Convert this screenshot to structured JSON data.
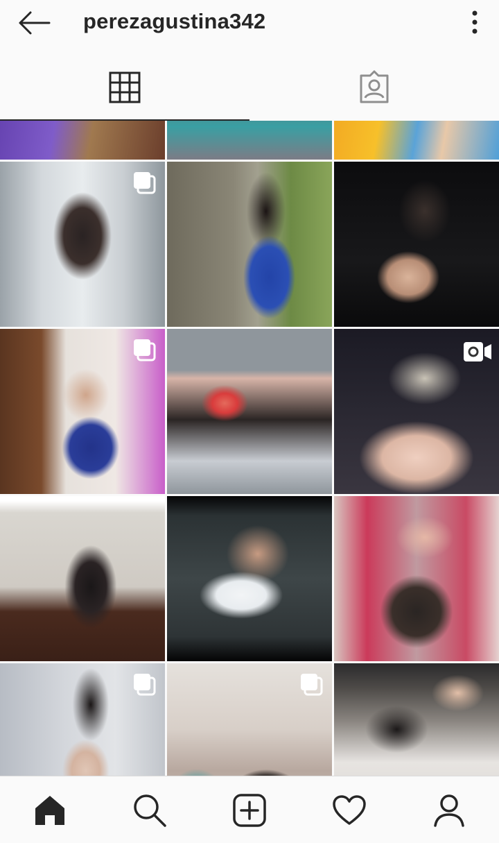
{
  "header": {
    "username": "perezagustina342",
    "back_icon": "arrow-left-icon",
    "more_icon": "vertical-dots-icon"
  },
  "tabs": [
    {
      "name": "grid",
      "icon": "grid-icon",
      "active": true
    },
    {
      "name": "tagged",
      "icon": "tagged-person-icon",
      "active": false
    }
  ],
  "grid": {
    "tiles": [
      {
        "id": "row0-col0",
        "badge": null
      },
      {
        "id": "row0-col1",
        "badge": null
      },
      {
        "id": "row0-col2",
        "badge": null
      },
      {
        "id": "row1-col0",
        "badge": "carousel-icon"
      },
      {
        "id": "row1-col1",
        "badge": null
      },
      {
        "id": "row1-col2",
        "badge": null
      },
      {
        "id": "row2-col0",
        "badge": "carousel-icon"
      },
      {
        "id": "row2-col1",
        "badge": null
      },
      {
        "id": "row2-col2",
        "badge": "video-icon"
      },
      {
        "id": "row3-col0",
        "badge": null
      },
      {
        "id": "row3-col1",
        "badge": null
      },
      {
        "id": "row3-col2",
        "badge": null
      },
      {
        "id": "row4-col0",
        "badge": "carousel-icon"
      },
      {
        "id": "row4-col1",
        "badge": "carousel-icon"
      },
      {
        "id": "row4-col2",
        "badge": null
      }
    ]
  },
  "bottom_nav": [
    {
      "name": "home",
      "icon": "home-icon",
      "active": true
    },
    {
      "name": "search",
      "icon": "search-icon",
      "active": false
    },
    {
      "name": "new-post",
      "icon": "plus-square-icon",
      "active": false
    },
    {
      "name": "activity",
      "icon": "heart-icon",
      "active": false
    },
    {
      "name": "profile",
      "icon": "person-icon",
      "active": false
    }
  ],
  "colors": {
    "background": "#fafafa",
    "text": "#262626",
    "inactive_icon": "#8e8e8e",
    "divider": "#dbdbdb"
  }
}
